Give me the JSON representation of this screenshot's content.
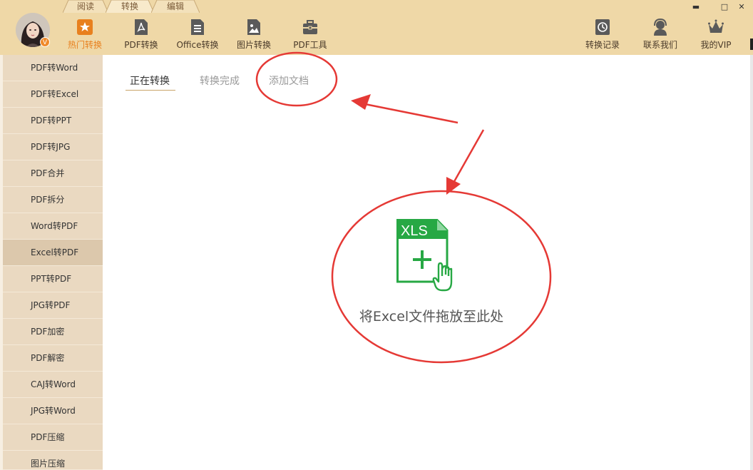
{
  "menu_tabs": [
    "阅读",
    "转换",
    "编辑"
  ],
  "tools": [
    "热门转换",
    "PDF转换",
    "Office转换",
    "图片转换",
    "PDF工具"
  ],
  "right_tools": [
    "转换记录",
    "联系我们",
    "我的VIP"
  ],
  "avatar_badge": "V",
  "window_controls": {
    "close": "✕",
    "maximize": "□",
    "minimize": "▬"
  },
  "sidebar": [
    "PDF转Word",
    "PDF转Excel",
    "PDF转PPT",
    "PDF转JPG",
    "PDF合并",
    "PDF拆分",
    "Word转PDF",
    "Excel转PDF",
    "PPT转PDF",
    "JPG转PDF",
    "PDF加密",
    "PDF解密",
    "CAJ转Word",
    "JPG转Word",
    "PDF压缩",
    "图片压缩"
  ],
  "sidebar_active": "Excel转PDF",
  "content_tabs": [
    "正在转换",
    "转换完成",
    "添加文档"
  ],
  "drop": {
    "file_type": "XLS",
    "text": "将Excel文件拖放至此处"
  },
  "colors": {
    "topbar": "#efd8a7",
    "accent": "#e8801e",
    "sidebar": "#ead9c1",
    "xls_green": "#27a844",
    "annotation": "#e53935"
  }
}
